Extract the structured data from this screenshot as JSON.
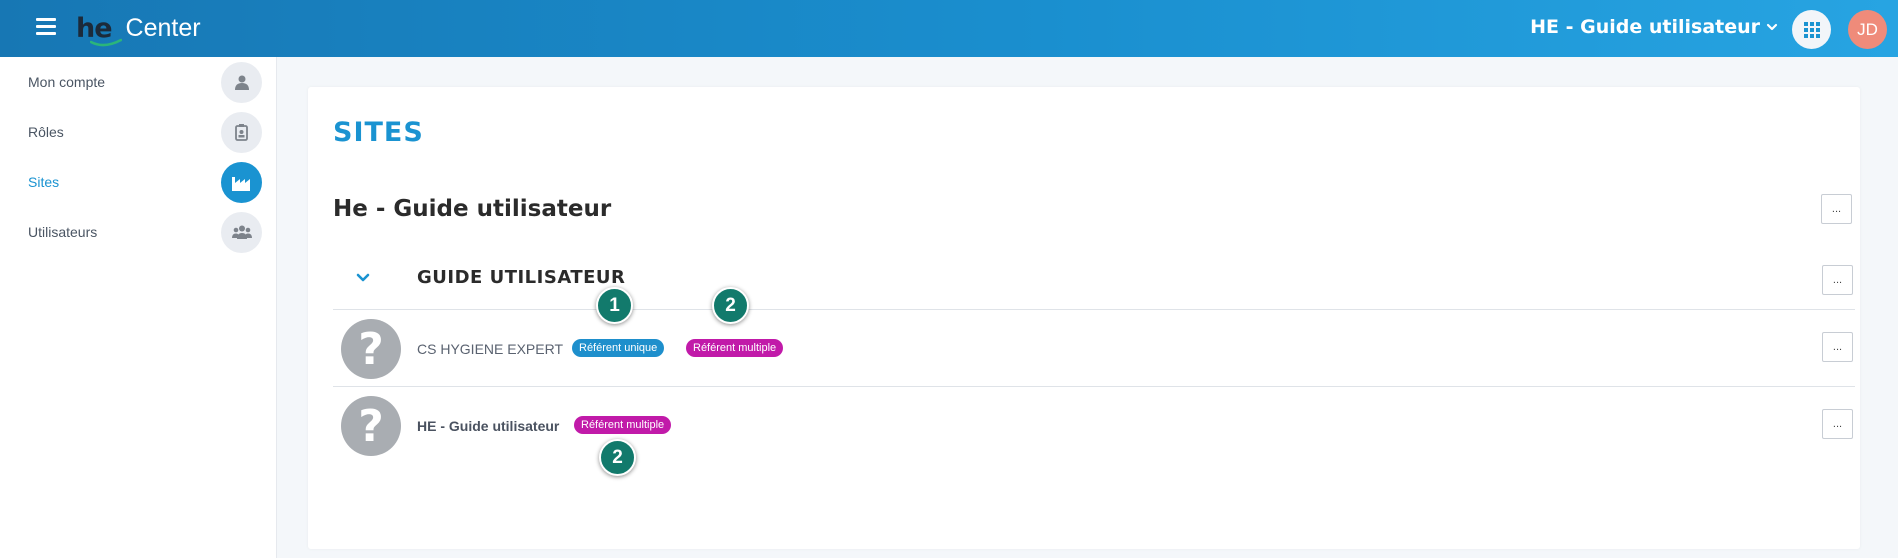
{
  "header": {
    "logo_brand": "he",
    "logo_text": "Center",
    "site_selector": "HE - Guide utilisateur",
    "user_initials": "JD",
    "colors": {
      "accent": "#1a93d1",
      "avatar": "#ef8b7a"
    }
  },
  "sidebar": {
    "items": [
      {
        "label": "Mon compte",
        "icon": "user-icon",
        "active": false
      },
      {
        "label": "Rôles",
        "icon": "id-badge-icon",
        "active": false
      },
      {
        "label": "Sites",
        "icon": "factory-icon",
        "active": true
      },
      {
        "label": "Utilisateurs",
        "icon": "users-icon",
        "active": false
      }
    ]
  },
  "main": {
    "page_title": "SITES",
    "site_title": "He - Guide utilisateur",
    "more_label": "...",
    "group": {
      "title": "GUIDE UTILISATEUR",
      "rows": [
        {
          "name": "CS HYGIENE EXPERT",
          "avatar_glyph": "?",
          "badges": [
            "Référent unique",
            "Référent multiple"
          ],
          "markers": [
            "1",
            "2"
          ]
        },
        {
          "name": "HE - Guide utilisateur",
          "avatar_glyph": "?",
          "badges": [
            "Référent multiple"
          ],
          "markers": [
            "2"
          ]
        }
      ]
    }
  }
}
